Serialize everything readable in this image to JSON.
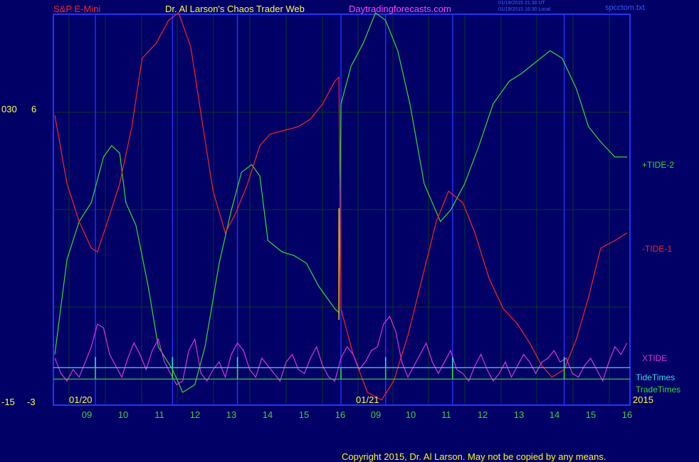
{
  "header": {
    "symbol": "S&P E-Mini",
    "title": "Dr. Al Larson's Chaos Trader Web",
    "site": "Daytradingforecasts.com",
    "timestamp_line1": "01/19/2015 21:30 UT",
    "timestamp_line2": "01/19/2015 16:30 Local",
    "filename": "spcctom.txt"
  },
  "footer": {
    "copyright": "Copyright 2015, Dr. Al Larson. May not be copied by any means."
  },
  "colors": {
    "background": "#000066",
    "frame": "#2233ff",
    "grid": "#0a3a20",
    "tide_plus": "#33dd33",
    "tide_minus": "#ff2222",
    "xtide": "#dd33dd",
    "tide_times": "#33dddd",
    "trade_times": "#33dd33",
    "axis_text": "#ffff44",
    "hour_text": "#44cc44"
  },
  "chart_data": {
    "type": "line",
    "x_unit": "hour of day, two sessions",
    "date_labels": [
      "01/20",
      "01/21"
    ],
    "year_label": "2015",
    "x_tick_labels": [
      "09",
      "10",
      "11",
      "12",
      "13",
      "14",
      "15",
      "16",
      "09",
      "10",
      "11",
      "12",
      "13",
      "14",
      "15",
      "16"
    ],
    "y_tick_labels_left": [
      "030",
      "-15"
    ],
    "y_tick_labels_right": [
      "6",
      "-3"
    ],
    "grid": true,
    "series": [
      {
        "name": "+TIDE-2",
        "color": "#33dd33",
        "points": [
          [
            0,
            10
          ],
          [
            0.3,
            35
          ],
          [
            0.6,
            45
          ],
          [
            0.9,
            50
          ],
          [
            1.05,
            56
          ],
          [
            1.2,
            62
          ],
          [
            1.4,
            65
          ],
          [
            1.6,
            63
          ],
          [
            1.75,
            50
          ],
          [
            2.0,
            44
          ],
          [
            2.3,
            28
          ],
          [
            2.55,
            12
          ],
          [
            2.9,
            6
          ],
          [
            3.15,
            0
          ],
          [
            3.45,
            2
          ],
          [
            3.7,
            12
          ],
          [
            4.05,
            34
          ],
          [
            4.35,
            48
          ],
          [
            4.6,
            58
          ],
          [
            4.85,
            60
          ],
          [
            5.05,
            57
          ],
          [
            5.25,
            40
          ],
          [
            5.6,
            37
          ],
          [
            5.9,
            36
          ],
          [
            6.2,
            34
          ],
          [
            6.5,
            28
          ],
          [
            6.9,
            22
          ],
          [
            7.0,
            21
          ],
          [
            7.05,
            76
          ],
          [
            7.3,
            86
          ],
          [
            7.6,
            92
          ],
          [
            7.9,
            100
          ],
          [
            8.15,
            98
          ],
          [
            8.45,
            90
          ],
          [
            8.75,
            76
          ],
          [
            9.1,
            55
          ],
          [
            9.5,
            45
          ],
          [
            9.75,
            48
          ],
          [
            10.1,
            55
          ],
          [
            10.45,
            65
          ],
          [
            10.8,
            76
          ],
          [
            11.2,
            82
          ],
          [
            11.5,
            84
          ],
          [
            11.85,
            87
          ],
          [
            12.2,
            90
          ],
          [
            12.5,
            88
          ],
          [
            12.85,
            80
          ],
          [
            13.15,
            70
          ],
          [
            13.45,
            66
          ],
          [
            13.8,
            62
          ],
          [
            14.1,
            62
          ]
        ]
      },
      {
        "name": "-TIDE-1",
        "color": "#ff2222",
        "points": [
          [
            0,
            73
          ],
          [
            0.3,
            55
          ],
          [
            0.6,
            45
          ],
          [
            0.9,
            38
          ],
          [
            1.05,
            37
          ],
          [
            1.3,
            45
          ],
          [
            1.6,
            55
          ],
          [
            1.9,
            70
          ],
          [
            2.15,
            88
          ],
          [
            2.5,
            92
          ],
          [
            2.8,
            98
          ],
          [
            3.05,
            100
          ],
          [
            3.35,
            91
          ],
          [
            3.65,
            70
          ],
          [
            3.9,
            53
          ],
          [
            4.2,
            42
          ],
          [
            4.45,
            47
          ],
          [
            4.75,
            55
          ],
          [
            5.05,
            65
          ],
          [
            5.3,
            68
          ],
          [
            5.65,
            69
          ],
          [
            6.0,
            70
          ],
          [
            6.3,
            72
          ],
          [
            6.6,
            76
          ],
          [
            6.9,
            82
          ],
          [
            7.0,
            83
          ],
          [
            7.05,
            22
          ],
          [
            7.35,
            10
          ],
          [
            7.7,
            0
          ],
          [
            8.05,
            -2
          ],
          [
            8.35,
            3
          ],
          [
            8.7,
            15
          ],
          [
            9.05,
            30
          ],
          [
            9.4,
            45
          ],
          [
            9.7,
            53
          ],
          [
            10.05,
            50
          ],
          [
            10.35,
            42
          ],
          [
            10.7,
            30
          ],
          [
            11.05,
            22
          ],
          [
            11.4,
            18
          ],
          [
            11.7,
            13
          ],
          [
            12.0,
            7
          ],
          [
            12.25,
            4
          ],
          [
            12.55,
            6
          ],
          [
            12.85,
            14
          ],
          [
            13.15,
            25
          ],
          [
            13.45,
            38
          ],
          [
            13.8,
            40
          ],
          [
            14.1,
            42
          ]
        ]
      },
      {
        "name": "XTIDE",
        "color": "#dd33dd",
        "points": [
          [
            0,
            9
          ],
          [
            0.15,
            5
          ],
          [
            0.3,
            3
          ],
          [
            0.45,
            6
          ],
          [
            0.6,
            4
          ],
          [
            0.75,
            8
          ],
          [
            0.9,
            12
          ],
          [
            1.05,
            18
          ],
          [
            1.2,
            17
          ],
          [
            1.35,
            10
          ],
          [
            1.5,
            7
          ],
          [
            1.65,
            4
          ],
          [
            1.8,
            9
          ],
          [
            1.95,
            13
          ],
          [
            2.1,
            10
          ],
          [
            2.25,
            6
          ],
          [
            2.4,
            11
          ],
          [
            2.55,
            14
          ],
          [
            2.7,
            8
          ],
          [
            2.85,
            5
          ],
          [
            3.0,
            2
          ],
          [
            3.15,
            3
          ],
          [
            3.3,
            11
          ],
          [
            3.45,
            14
          ],
          [
            3.6,
            5
          ],
          [
            3.75,
            3
          ],
          [
            3.9,
            6
          ],
          [
            4.05,
            8
          ],
          [
            4.2,
            4
          ],
          [
            4.35,
            10
          ],
          [
            4.5,
            13
          ],
          [
            4.65,
            11
          ],
          [
            4.8,
            6
          ],
          [
            4.95,
            4
          ],
          [
            5.1,
            9
          ],
          [
            5.25,
            7
          ],
          [
            5.4,
            5
          ],
          [
            5.55,
            3
          ],
          [
            5.7,
            8
          ],
          [
            5.85,
            10
          ],
          [
            6.0,
            6
          ],
          [
            6.15,
            5
          ],
          [
            6.3,
            9
          ],
          [
            6.45,
            12
          ],
          [
            6.6,
            7
          ],
          [
            6.75,
            4
          ],
          [
            6.9,
            3
          ],
          [
            7.05,
            9
          ],
          [
            7.2,
            12
          ],
          [
            7.35,
            10
          ],
          [
            7.5,
            6
          ],
          [
            7.65,
            8
          ],
          [
            7.8,
            11
          ],
          [
            7.95,
            12
          ],
          [
            8.1,
            18
          ],
          [
            8.25,
            20
          ],
          [
            8.4,
            16
          ],
          [
            8.55,
            8
          ],
          [
            8.7,
            4
          ],
          [
            8.85,
            7
          ],
          [
            9.0,
            10
          ],
          [
            9.15,
            13
          ],
          [
            9.3,
            8
          ],
          [
            9.45,
            5
          ],
          [
            9.6,
            8
          ],
          [
            9.75,
            11
          ],
          [
            9.9,
            6
          ],
          [
            10.05,
            5
          ],
          [
            10.2,
            3
          ],
          [
            10.35,
            7
          ],
          [
            10.5,
            10
          ],
          [
            10.65,
            6
          ],
          [
            10.8,
            3
          ],
          [
            10.95,
            5
          ],
          [
            11.1,
            8
          ],
          [
            11.25,
            4
          ],
          [
            11.4,
            7
          ],
          [
            11.55,
            10
          ],
          [
            11.7,
            8
          ],
          [
            11.85,
            5
          ],
          [
            12.0,
            8
          ],
          [
            12.15,
            9
          ],
          [
            12.3,
            11
          ],
          [
            12.45,
            8
          ],
          [
            12.6,
            9
          ],
          [
            12.75,
            5
          ],
          [
            12.9,
            4
          ],
          [
            13.05,
            7
          ],
          [
            13.2,
            9
          ],
          [
            13.35,
            6
          ],
          [
            13.5,
            3
          ],
          [
            13.65,
            8
          ],
          [
            13.8,
            12
          ],
          [
            13.95,
            10
          ],
          [
            14.1,
            13
          ]
        ]
      },
      {
        "name": "TideTimes",
        "color": "#33dddd",
        "baseline": 6.5,
        "spikes": [
          1.0,
          2.9,
          4.5,
          8.15,
          9.8,
          12.55
        ]
      },
      {
        "name": "TradeTimes",
        "color": "#33dd33",
        "baseline": 3.5,
        "spikes": [
          1.0,
          2.9,
          4.5,
          7.05,
          8.15,
          9.8,
          12.55
        ]
      }
    ],
    "xlim": [
      0,
      14.1
    ],
    "ylim": [
      -3,
      100
    ]
  }
}
